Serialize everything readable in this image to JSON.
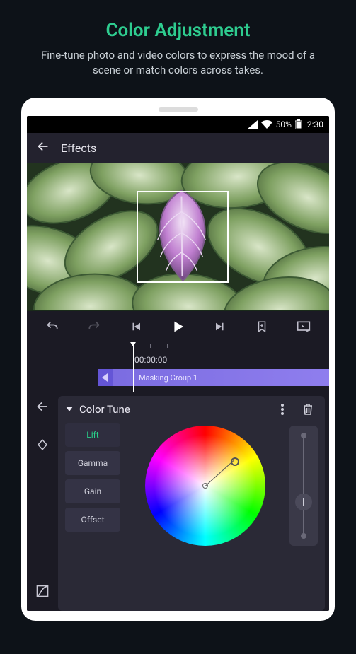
{
  "promo": {
    "title": "Color Adjustment",
    "subtitle": "Fine-tune photo and video colors to express the mood of a scene or match colors across takes."
  },
  "status": {
    "battery_pct": "50%",
    "time": "2:30"
  },
  "header": {
    "title": "Effects"
  },
  "timeline": {
    "timecode": "00:00:00",
    "clip_label": "Masking Group 1"
  },
  "color_tune": {
    "title": "Color Tune",
    "params": [
      "Lift",
      "Gamma",
      "Gain",
      "Offset"
    ],
    "active_param": "Lift"
  }
}
